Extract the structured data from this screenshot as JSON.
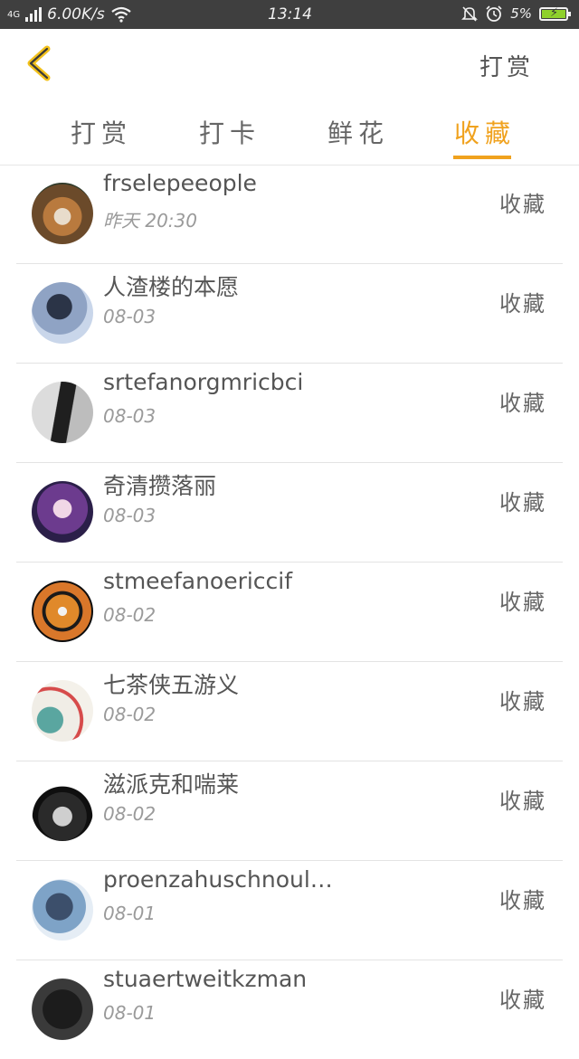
{
  "status_bar": {
    "network": "4G",
    "speed": "6.00K/s",
    "time": "13:14",
    "battery": "5%",
    "icons": [
      "signal-icon",
      "wifi-icon",
      "mute-icon",
      "alarm-icon",
      "battery-icon"
    ]
  },
  "header": {
    "back_icon": "chevron-left-icon",
    "right_action": "打赏",
    "accent_color": "#f0a21e"
  },
  "tabs": [
    {
      "label": "打赏",
      "active": false
    },
    {
      "label": "打卡",
      "active": false
    },
    {
      "label": "鲜花",
      "active": false
    },
    {
      "label": "收藏",
      "active": true
    }
  ],
  "list": [
    {
      "name": "frselepeeople",
      "date": "昨天 20:30",
      "action": "收藏"
    },
    {
      "name": "人渣楼的本愿",
      "date": "08-03",
      "action": "收藏"
    },
    {
      "name": "srtefanorgmricbci",
      "date": "08-03",
      "action": "收藏"
    },
    {
      "name": "奇清攒落丽",
      "date": "08-03",
      "action": "收藏"
    },
    {
      "name": "stmeefanoericcif",
      "date": "08-02",
      "action": "收藏"
    },
    {
      "name": "七茶侠五游义",
      "date": "08-02",
      "action": "收藏"
    },
    {
      "name": "滋派克和喘莱",
      "date": "08-02",
      "action": "收藏"
    },
    {
      "name": "proenzahuschnoul…",
      "date": "08-01",
      "action": "收藏"
    },
    {
      "name": "stuaertweitkzman",
      "date": "08-01",
      "action": "收藏"
    }
  ]
}
